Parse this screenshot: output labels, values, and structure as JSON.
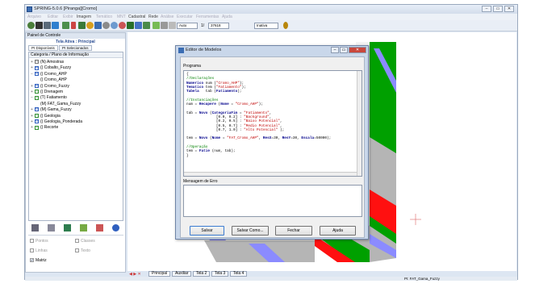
{
  "app": {
    "title": "SPRING-5.0.6 [Piranga][Cromo]",
    "window_controls": [
      "–",
      "▭",
      "✕"
    ]
  },
  "menubar": [
    "Arquivo",
    "Editar",
    "Exibir",
    "Imagem",
    "Temático",
    "MNT",
    "Cadastral",
    "Rede",
    "Análise",
    "Executar",
    "Ferramentas",
    "Ajuda"
  ],
  "toolbar": {
    "zoom_mode": "Auto",
    "scale_prefix": "1/",
    "scale_value": "37618",
    "mode": "Inativa"
  },
  "panel": {
    "title": "Painel de Controle",
    "subtitle": "Tela Ativa : Principal",
    "tabs": [
      "PI Disponíveis",
      "PI Selecionados"
    ],
    "tree_header": "Categoria / Plano de Informação",
    "tree": [
      {
        "expander": "+",
        "type": "N",
        "label": "(N) Amostras"
      },
      {
        "expander": "+",
        "type": "M",
        "label": "() Cobalto_Fuzzy"
      },
      {
        "expander": "−",
        "type": "M",
        "label": "() Cromo_AHP"
      },
      {
        "expander": "",
        "type": "",
        "label": "() Cromo_AHP"
      },
      {
        "expander": "+",
        "type": "M",
        "label": "() Cromo_Fuzzy"
      },
      {
        "expander": "+",
        "type": "T",
        "label": "() Drenagem"
      },
      {
        "expander": "−",
        "type": "T",
        "label": "(T) Fatiamento"
      },
      {
        "expander": "",
        "type": "",
        "label": "(M) FAT_Gama_Fuzzy"
      },
      {
        "expander": "+",
        "type": "M",
        "label": "(M) Gama_Fuzzy"
      },
      {
        "expander": "+",
        "type": "T",
        "label": "() Geologia"
      },
      {
        "expander": "+",
        "type": "M",
        "label": "() Geologia_Ponderada"
      },
      {
        "expander": "+",
        "type": "T",
        "label": "() Recorte"
      }
    ],
    "checks": [
      {
        "label": "Pontos",
        "checked": false
      },
      {
        "label": "Classes",
        "checked": false
      },
      {
        "label": "Linhas",
        "checked": false
      },
      {
        "label": "Texto",
        "checked": false
      },
      {
        "label": "Matriz",
        "checked": true
      }
    ]
  },
  "view_tabs": [
    "Principal",
    "Auxiliar",
    "Tela 2",
    "Tela 3",
    "Tela 4"
  ],
  "status": {
    "right": "PI: FAT_Gama_Fuzzy"
  },
  "dialog": {
    "title": "Editor de Modelos",
    "program_label": "Programa",
    "code_lines": [
      [
        {
          "t": "{",
          "c": ""
        }
      ],
      [
        {
          "t": "//Declarações",
          "c": "cm"
        }
      ],
      [
        {
          "t": "Numerico",
          "c": "kw"
        },
        {
          "t": " num (",
          "c": ""
        },
        {
          "t": "\"Cromo_AHP\"",
          "c": "st"
        },
        {
          "t": ");",
          "c": ""
        }
      ],
      [
        {
          "t": "Tematico",
          "c": "kw"
        },
        {
          "t": " tem (",
          "c": ""
        },
        {
          "t": "\"Fatiamento\"",
          "c": "st"
        },
        {
          "t": ");",
          "c": ""
        }
      ],
      [
        {
          "t": "Tabela",
          "c": "kw"
        },
        {
          "t": "   tab (",
          "c": ""
        },
        {
          "t": "Fatiamento",
          "c": "kw"
        },
        {
          "t": ");",
          "c": ""
        }
      ],
      [
        {
          "t": "",
          "c": ""
        }
      ],
      [
        {
          "t": "//Instanciações",
          "c": "cm"
        }
      ],
      [
        {
          "t": "num = ",
          "c": ""
        },
        {
          "t": "Recupere",
          "c": "kw"
        },
        {
          "t": " (",
          "c": ""
        },
        {
          "t": "Nome",
          "c": "kw"
        },
        {
          "t": " = ",
          "c": ""
        },
        {
          "t": "\"Cromo_AHP\"",
          "c": "st"
        },
        {
          "t": ");",
          "c": ""
        }
      ],
      [
        {
          "t": "",
          "c": ""
        }
      ],
      [
        {
          "t": "tab = ",
          "c": ""
        },
        {
          "t": "Novo",
          "c": "kw"
        },
        {
          "t": " (",
          "c": ""
        },
        {
          "t": "CategoriaFim",
          "c": "kw"
        },
        {
          "t": " = ",
          "c": ""
        },
        {
          "t": "\"Fatiamento\"",
          "c": "st"
        },
        {
          "t": ",",
          "c": ""
        }
      ],
      [
        {
          "t": "              [0.0, 0.2] : ",
          "c": ""
        },
        {
          "t": "\"Background\"",
          "c": "st"
        },
        {
          "t": ",",
          "c": ""
        }
      ],
      [
        {
          "t": "              [0.2, 0.5] : ",
          "c": ""
        },
        {
          "t": "\"Baixo Potencial\"",
          "c": "st"
        },
        {
          "t": ",",
          "c": ""
        }
      ],
      [
        {
          "t": "              [0.5, 0.7] : ",
          "c": ""
        },
        {
          "t": "\"Medio Potencial\"",
          "c": "st"
        },
        {
          "t": ",",
          "c": ""
        }
      ],
      [
        {
          "t": "              [0.7, 1.0] : ",
          "c": ""
        },
        {
          "t": "\"Alto Potencial\"",
          "c": "st"
        },
        {
          "t": " );",
          "c": ""
        }
      ],
      [
        {
          "t": "",
          "c": ""
        }
      ],
      [
        {
          "t": "tem = ",
          "c": ""
        },
        {
          "t": "Novo",
          "c": "kw"
        },
        {
          "t": " (",
          "c": ""
        },
        {
          "t": "Nome",
          "c": "kw"
        },
        {
          "t": " = ",
          "c": ""
        },
        {
          "t": "\"FAT_Cromo_AHP\"",
          "c": "st"
        },
        {
          "t": ", ",
          "c": ""
        },
        {
          "t": "ResX",
          "c": "kw"
        },
        {
          "t": "=30, ",
          "c": ""
        },
        {
          "t": "ResY",
          "c": "kw"
        },
        {
          "t": "=30, ",
          "c": ""
        },
        {
          "t": "Escala",
          "c": "kw"
        },
        {
          "t": "=50000);",
          "c": ""
        }
      ],
      [
        {
          "t": "",
          "c": ""
        }
      ],
      [
        {
          "t": "//Operação",
          "c": "cm"
        }
      ],
      [
        {
          "t": "tem = ",
          "c": ""
        },
        {
          "t": "Fatie",
          "c": "kw"
        },
        {
          "t": " (num, tab);",
          "c": ""
        }
      ],
      [
        {
          "t": "}",
          "c": ""
        }
      ]
    ],
    "errors_label": "Mensagem de Erro",
    "errors_text": "",
    "buttons": [
      "Salvar",
      "Salvar Como...",
      "Fechar",
      "Ajuda"
    ]
  }
}
